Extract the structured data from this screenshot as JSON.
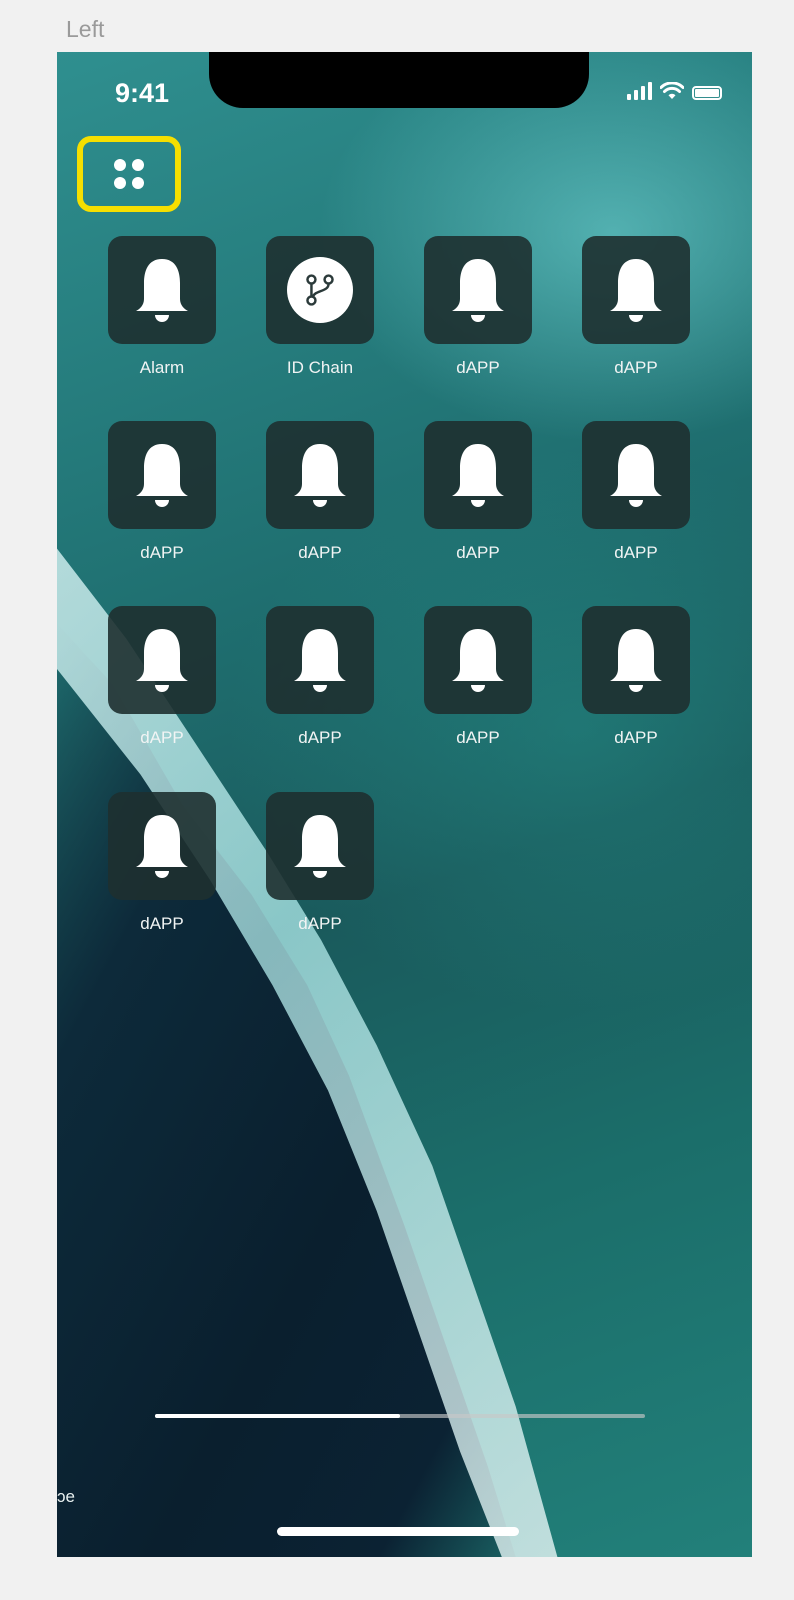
{
  "frame": {
    "label": "Left"
  },
  "status_bar": {
    "time": "9:41",
    "icons": [
      "signal-icon",
      "wifi-icon",
      "battery-icon"
    ]
  },
  "menu": {
    "icon": "grid-dots-icon",
    "highlight_color": "#f6df00"
  },
  "apps": [
    {
      "label": "Alarm",
      "icon": "bell-icon"
    },
    {
      "label": "ID Chain",
      "icon": "id-chain-icon"
    },
    {
      "label": "dAPP",
      "icon": "bell-icon"
    },
    {
      "label": "dAPP",
      "icon": "bell-icon"
    },
    {
      "label": "dAPP",
      "icon": "bell-icon"
    },
    {
      "label": "dAPP",
      "icon": "bell-icon"
    },
    {
      "label": "dAPP",
      "icon": "bell-icon"
    },
    {
      "label": "dAPP",
      "icon": "bell-icon"
    },
    {
      "label": "dAPP",
      "icon": "bell-icon"
    },
    {
      "label": "dAPP",
      "icon": "bell-icon"
    },
    {
      "label": "dAPP",
      "icon": "bell-icon"
    },
    {
      "label": "dAPP",
      "icon": "bell-icon"
    },
    {
      "label": "dAPP",
      "icon": "bell-icon"
    },
    {
      "label": "dAPP",
      "icon": "bell-icon"
    }
  ],
  "page_indicator": {
    "progress": 0.5
  },
  "corner_text": "ɔe"
}
